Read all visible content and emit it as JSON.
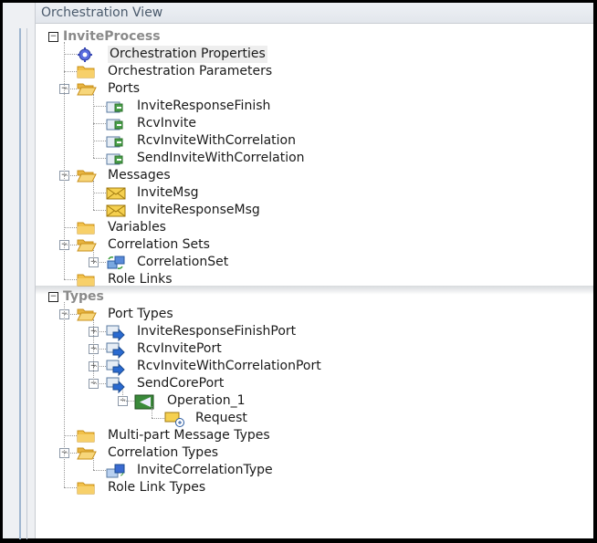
{
  "header": {
    "title": "Orchestration View"
  },
  "tree": [
    {
      "label": "InviteProcess",
      "level": 0,
      "icon": "none",
      "exp": "minus",
      "section": true
    },
    {
      "label": "Orchestration Properties",
      "level": 1,
      "icon": "gear",
      "exp": "none",
      "selected": true
    },
    {
      "label": "Orchestration Parameters",
      "level": 1,
      "icon": "folder",
      "exp": "none"
    },
    {
      "label": "Ports",
      "level": 1,
      "icon": "folder-open",
      "exp": "minus"
    },
    {
      "label": "InviteResponseFinish",
      "level": 2,
      "icon": "port",
      "exp": "none"
    },
    {
      "label": "RcvInvite",
      "level": 2,
      "icon": "port",
      "exp": "none"
    },
    {
      "label": "RcvInviteWithCorrelation",
      "level": 2,
      "icon": "port",
      "exp": "none"
    },
    {
      "label": "SendInviteWithCorrelation",
      "level": 2,
      "icon": "port",
      "exp": "none"
    },
    {
      "label": "Messages",
      "level": 1,
      "icon": "folder-open",
      "exp": "minus"
    },
    {
      "label": "InviteMsg",
      "level": 2,
      "icon": "message",
      "exp": "none"
    },
    {
      "label": "InviteResponseMsg",
      "level": 2,
      "icon": "message",
      "exp": "none"
    },
    {
      "label": "Variables",
      "level": 1,
      "icon": "folder",
      "exp": "none"
    },
    {
      "label": "Correlation Sets",
      "level": 1,
      "icon": "folder-open",
      "exp": "minus"
    },
    {
      "label": "CorrelationSet",
      "level": 2,
      "icon": "correlation",
      "exp": "plus"
    },
    {
      "label": "Role Links",
      "level": 1,
      "icon": "folder",
      "exp": "none"
    },
    {
      "label": "Types",
      "level": 0,
      "icon": "none",
      "exp": "minus",
      "section": true
    },
    {
      "label": "Port Types",
      "level": 1,
      "icon": "folder-open",
      "exp": "minus"
    },
    {
      "label": "InviteResponseFinishPort",
      "level": 2,
      "icon": "port-type",
      "exp": "plus"
    },
    {
      "label": "RcvInvitePort",
      "level": 2,
      "icon": "port-type",
      "exp": "plus"
    },
    {
      "label": "RcvInviteWithCorrelationPort",
      "level": 2,
      "icon": "port-type",
      "exp": "plus"
    },
    {
      "label": "SendCorePort",
      "level": 2,
      "icon": "port-type",
      "exp": "minus"
    },
    {
      "label": "Operation_1",
      "level": 3,
      "icon": "operation",
      "exp": "minus"
    },
    {
      "label": "Request",
      "level": 4,
      "icon": "request",
      "exp": "none"
    },
    {
      "label": "Multi-part Message Types",
      "level": 1,
      "icon": "folder",
      "exp": "none"
    },
    {
      "label": "Correlation Types",
      "level": 1,
      "icon": "folder-open",
      "exp": "minus"
    },
    {
      "label": "InviteCorrelationType",
      "level": 2,
      "icon": "correlation-type",
      "exp": "none"
    },
    {
      "label": "Role Link Types",
      "level": 1,
      "icon": "folder",
      "exp": "none"
    }
  ]
}
